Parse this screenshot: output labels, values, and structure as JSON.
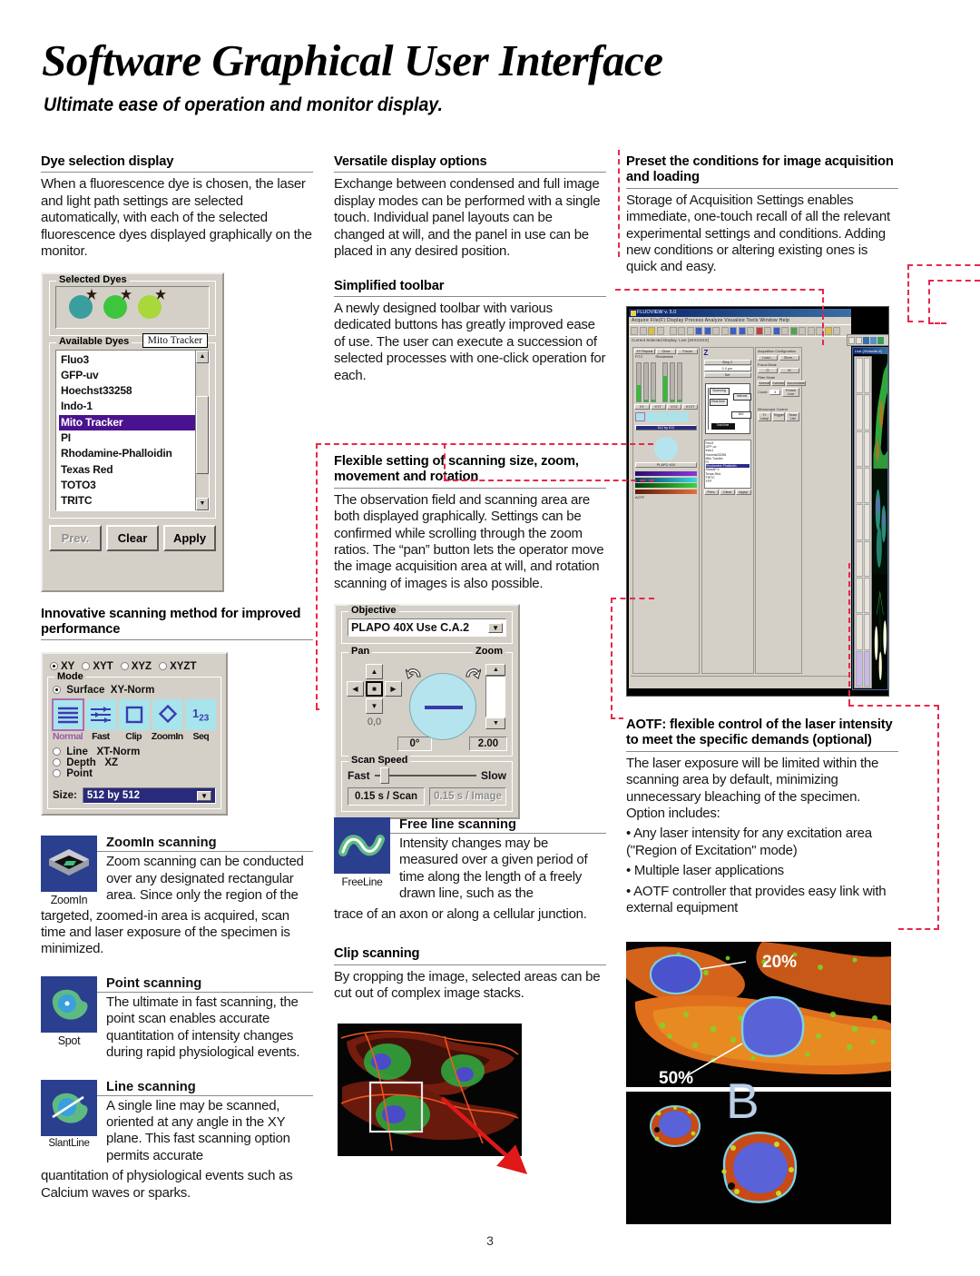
{
  "header": {
    "title": "Software Graphical User Interface",
    "subtitle": "Ultimate ease of operation and monitor display."
  },
  "page_number": "3",
  "sections": {
    "dye_selection": {
      "heading": "Dye selection display",
      "body": "When a fluorescence dye is chosen, the laser and light path settings are selected automatically, with each of the selected fluorescence dyes displayed graphically on the monitor."
    },
    "versatile_display": {
      "heading": "Versatile display options",
      "body": "Exchange between condensed and full image display modes can be performed with a single touch. Individual panel layouts can be changed at will, and the panel in use can be placed in any desired position."
    },
    "simplified_toolbar": {
      "heading": "Simplified toolbar",
      "body": "A newly designed toolbar with various dedicated buttons has greatly improved ease of use. The user can execute a succession of selected processes with one-click operation for each."
    },
    "preset_conditions": {
      "heading": "Preset the conditions for image acquisition and loading",
      "body": "Storage of Acquisition Settings enables immediate, one-touch recall of all the relevant experimental settings and conditions. Adding new conditions or altering existing ones is quick and easy."
    },
    "flexible_setting": {
      "heading": "Flexible setting of scanning size, zoom, movement and rotation",
      "body": "The observation field and scanning area are both displayed graphically. Settings can be confirmed while scrolling through the zoom ratios. The “pan” button lets the operator move the image acquisition area at will, and rotation scanning of images is also possible."
    },
    "innovative_scanning": {
      "heading": "Innovative scanning method for improved performance"
    },
    "aotf": {
      "heading": "AOTF: flexible control of the laser intensity to meet the specific demands (optional)",
      "body": "The laser exposure will be limited within the scanning area by default, minimizing unnecessary bleaching of the specimen. Option includes:",
      "bullets": [
        "• Any laser intensity for any excitation area (\"Region of Excitation\" mode)",
        "• Multiple laser applications",
        "• AOTF controller that provides easy link with external equipment"
      ]
    },
    "zoomin_scanning": {
      "heading": "ZoomIn scanning",
      "icon_label": "ZoomIn",
      "body_wrap": "Zoom scanning can be conducted over any designated rectangular area. Since only the region of the",
      "body_rest": "targeted, zoomed-in area is acquired, scan time and laser exposure of the specimen is minimized."
    },
    "point_scanning": {
      "heading": "Point scanning",
      "icon_label": "Spot",
      "body_wrap": "The ultimate in fast scanning, the point scan enables accurate quantitation of intensity changes during rapid physiological events."
    },
    "line_scanning": {
      "heading": "Line scanning",
      "icon_label": "SlantLine",
      "body_wrap": "A single line may be scanned, oriented at any angle in the XY plane. This fast scanning option permits accurate",
      "body_rest": "quantitation of physiological events such as Calcium waves or sparks."
    },
    "free_line_scanning": {
      "heading": "Free line scanning",
      "icon_label": "FreeLine",
      "body_wrap": "Intensity changes may be measured over a given period of time along the length of a freely drawn line, such as the",
      "body_rest": "trace of an axon or along a cellular junction."
    },
    "clip_scanning": {
      "heading": "Clip scanning",
      "body": "By cropping the image, selected areas can be cut out of complex image stacks."
    }
  },
  "dye_dialog": {
    "selected_dyes_label": "Selected Dyes",
    "available_dyes_label": "Available Dyes",
    "tooltip": "Mito Tracker",
    "swatch_colors": [
      "#3a9e9e",
      "#3dc63d",
      "#a8d83a"
    ],
    "dye_list": [
      "Fluo3",
      "GFP-uv",
      "Hoechst33258",
      "Indo-1",
      "Mito Tracker",
      "PI",
      "Rhodamine-Phalloidin",
      "Texas Red",
      "TOTO3",
      "TRITC"
    ],
    "selected_dye": "Mito Tracker",
    "selected_color": "#4b128f",
    "buttons": [
      "Prev.",
      "Clear",
      "Apply"
    ]
  },
  "scan_dialog": {
    "scan_types": [
      "XY",
      "XYT",
      "XYZ",
      "XYZT"
    ],
    "selected_scan_type": "XY",
    "mode_label": "Mode",
    "mode_options": [
      {
        "label": "Surface",
        "value": "XY-Norm",
        "selected": true
      },
      {
        "label": "Line",
        "value": "XT-Norm",
        "selected": false
      },
      {
        "label": "Depth",
        "value": "XZ",
        "selected": false
      },
      {
        "label": "Point",
        "value": "",
        "selected": false
      }
    ],
    "mode_icons": [
      "Normal",
      "Fast",
      "Clip",
      "ZoomIn",
      "Seq"
    ],
    "active_mode_icon": "Normal",
    "size_label": "Size:",
    "size_value": "512 by 512"
  },
  "objective_dialog": {
    "objective_label": "Objective",
    "objective_value": "PLAPO 40X",
    "objective_ca": "Use C.A.2",
    "pan_label": "Pan",
    "pan_position": "0,0",
    "rotation": "0°",
    "zoom_label": "Zoom",
    "zoom_value": "2.00",
    "scan_speed_label": "Scan Speed",
    "speed_fast": "Fast",
    "speed_slow": "Slow",
    "time_per_scan": "0.15 s / Scan",
    "time_per_image": "0.15 s / Image"
  },
  "app_screenshot": {
    "title": "FLUOVIEW v. 5.0",
    "menu": "Acquire  File(F)  Display  Process  Analyze  Visualize  Tools  Window  Help",
    "status": "Current Selected Display: Live (3XXXXXX)",
    "buttons_row": [
      "XY Repeat",
      "Once",
      "Focus"
    ],
    "channels": [
      "FITC",
      "Rhodamine"
    ],
    "acq_config_label": "Acquisition Configuration",
    "acq_buttons": [
      "Load...",
      "Store..."
    ],
    "focus_mode_label": "Focus Mode",
    "filter_mode_label": "Filter Mode",
    "filter_buttons": [
      "Normal",
      "Kalman",
      "Accumulate"
    ],
    "count_label": "Count:",
    "count_value": "3",
    "microscope_control_label": "Microscope Control",
    "micro_buttons": [
      "Tr Lamp",
      "Trigger",
      "Scan List"
    ],
    "live_window_title": "Live (3Xdocile d)",
    "dye_list_title": "Available Dyes",
    "dye_list": [
      "Fluo3",
      "GFP-uv",
      "Indo1",
      "Hoechst33258",
      "Mito Tracker",
      "PI",
      "Rhodamine-Phalloidin",
      "SlowAP-1",
      "Texas Red",
      "TRITC",
      "YFP"
    ],
    "dye_selected": "Rhodamine-Phalloidin",
    "dye_buttons": [
      "Prev.",
      "Clear",
      "Apply"
    ],
    "aotf_label": "AOTF",
    "laser_label": "Laser Intensity",
    "step_label": "Step 2",
    "current_pos_label": "Current Pos.",
    "current_pos_value": "0.0 µm",
    "step_size_label": "Step Size",
    "step_size_value": "1.0 µm",
    "set_button": "Set"
  },
  "photos": {
    "aotf_label_20": "20%",
    "aotf_label_50": "50%",
    "panel_letter": "B"
  }
}
